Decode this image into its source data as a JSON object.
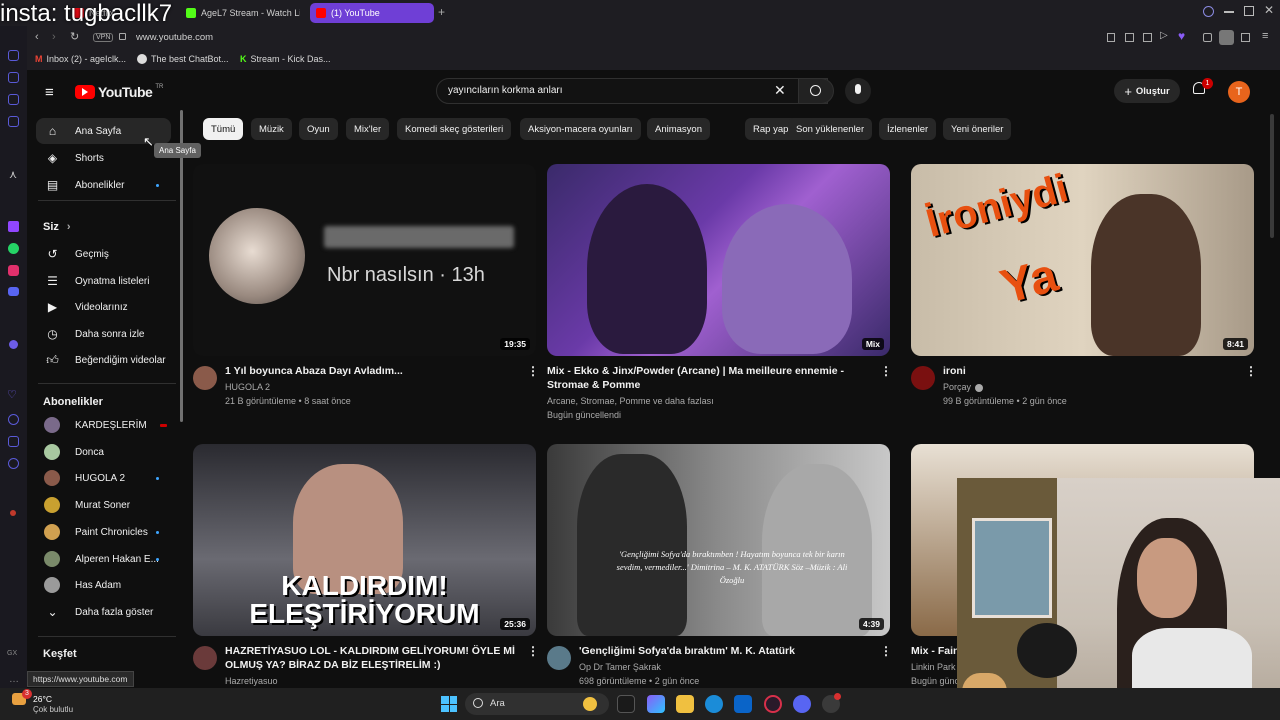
{
  "overlay_text": "insta: tugbacllk7",
  "tabs": [
    {
      "label": "Netflix"
    },
    {
      "label": "AgeL7 Stream - Watch Li"
    },
    {
      "label": "(1) YouTube"
    }
  ],
  "address": {
    "vpn": "VPN",
    "url": "www.youtube.com"
  },
  "bookmarks": [
    {
      "label": "Inbox (2) - ageIclk..."
    },
    {
      "label": "The best ChatBot..."
    },
    {
      "label": "Stream - Kick Das..."
    }
  ],
  "youtube": {
    "logo": "YouTube",
    "logo_sup": "TR",
    "search_value": "yayıncıların korkma anları",
    "create_label": "Oluştur",
    "notif_count": "1",
    "avatar_letter": "T",
    "tooltip": "Ana Sayfa",
    "nav": [
      {
        "label": "Ana Sayfa",
        "icon": "home-icon"
      },
      {
        "label": "Shorts",
        "icon": "shorts-icon"
      },
      {
        "label": "Abonelikler",
        "icon": "subscriptions-icon"
      }
    ],
    "you_header": "Siz",
    "you_items": [
      {
        "label": "Geçmiş",
        "icon": "history-icon"
      },
      {
        "label": "Oynatma listeleri",
        "icon": "playlist-icon"
      },
      {
        "label": "Videolarınız",
        "icon": "your-videos-icon"
      },
      {
        "label": "Daha sonra izle",
        "icon": "watch-later-icon"
      },
      {
        "label": "Beğendiğim videolar",
        "icon": "liked-icon"
      }
    ],
    "subs_header": "Abonelikler",
    "subs": [
      {
        "label": "KARDEŞLERİM",
        "color": "#7a6a8a"
      },
      {
        "label": "Donca",
        "color": "#a8c8a0"
      },
      {
        "label": "HUGOLA 2",
        "color": "#8a5a4a"
      },
      {
        "label": "Murat Soner",
        "color": "#c8a030"
      },
      {
        "label": "Paint Chronicles",
        "color": "#d0a050"
      },
      {
        "label": "Alperen Hakan E...",
        "color": "#7a8a6a"
      },
      {
        "label": "Has Adam",
        "color": "#9a9a9a"
      }
    ],
    "show_more": "Daha fazla göster",
    "explore_header": "Keşfet",
    "status_url": "https://www.youtube.com",
    "chips": [
      "Tümü",
      "Müzik",
      "Oyun",
      "Mix'ler",
      "Komedi skeç gösterileri",
      "Aksiyon-macera oyunları",
      "Animasyon",
      "Rap yapma",
      "Son yüklenenler",
      "İzlenenler",
      "Yeni öneriler"
    ],
    "thumb1_text": "Nbr nasılsın · 13h",
    "thumb3_text1": "İroniydi",
    "thumb3_text2": "Ya",
    "thumb4_text1": "KALDIRDIM!",
    "thumb4_text2": "ELEŞTİRİYORUM",
    "thumb5_quote": "'Gençliğimi Sofya'da bıraktımben ! Hayatım boyunca tek bir karın sevdim, vermediler...' Dimitrina – M. K. ATATÜRK  Söz –Müzik : Ali Özoğlu",
    "mix_badge": "Mix",
    "videos": [
      {
        "title": "1 Yıl boyunca Abaza Dayı Avladım...",
        "channel": "HUGOLA 2",
        "meta": "21 B görüntüleme • 8 saat önce",
        "duration": "19:35"
      },
      {
        "title": "Mix - Ekko & Jinx/Powder (Arcane) | Ma meilleure ennemie - Stromae & Pomme",
        "channel": "Arcane, Stromae, Pomme ve daha fazlası",
        "meta": "Bugün güncellendi",
        "duration": ""
      },
      {
        "title": "ironi",
        "channel": "Porçay",
        "meta": "99 B görüntüleme • 2 gün önce",
        "duration": "8:41"
      },
      {
        "title": "HAZRETİYASUO LOL - KALDIRDIM GELİYORUM! ÖYLE Mİ OLMUŞ YA? BİRAZ DA BİZ ELEŞTİRELİM :)",
        "channel": "Hazretiyasuo",
        "meta": "",
        "duration": "25:36"
      },
      {
        "title": "'Gençliğimi Sofya'da bıraktım' M. K. Atatürk",
        "channel": "Op Dr Tamer Şakrak",
        "meta": "698 görüntüleme • 2 gün önce",
        "duration": "4:39"
      },
      {
        "title": "Mix - Fain",
        "channel": "Linkin Park",
        "meta": "Bugün günc",
        "duration": ""
      }
    ]
  },
  "taskbar": {
    "temp": "26°C",
    "weather": "Çok bulutlu",
    "search": "Ara",
    "badge": "3"
  },
  "colors": {
    "accent": "#6f3fd6",
    "yt_red": "#ff0000",
    "avatar": "#e8641c"
  }
}
